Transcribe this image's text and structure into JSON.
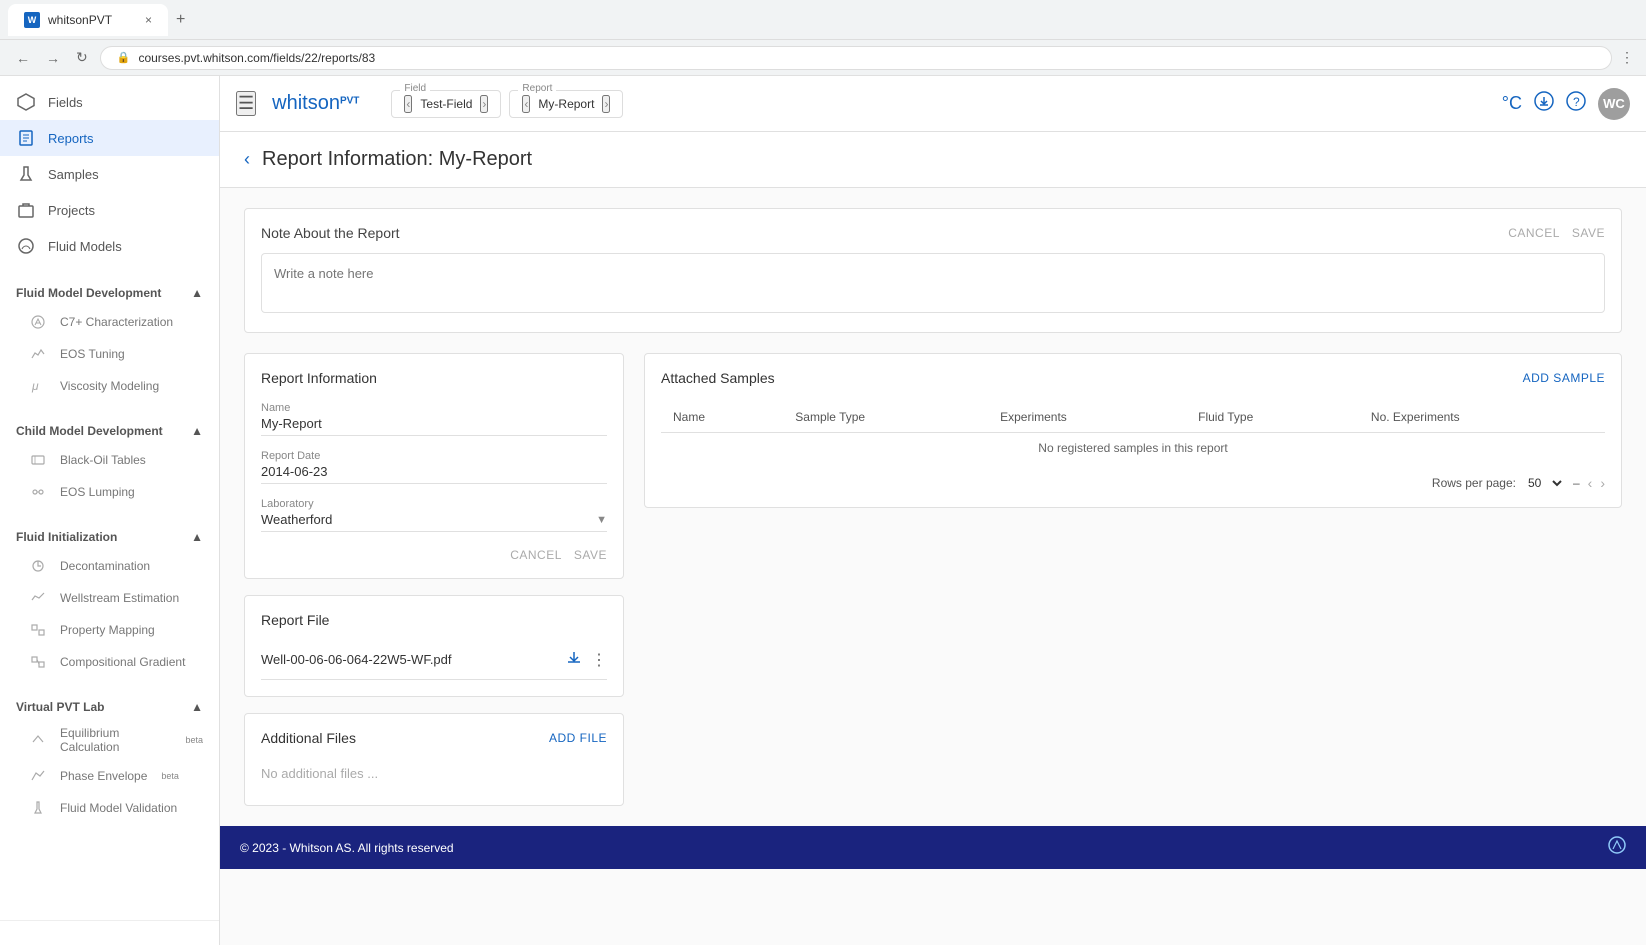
{
  "browser": {
    "tab_label": "whitsonPVT",
    "url": "courses.pvt.whitson.com/fields/22/reports/83",
    "favicon": "W"
  },
  "header": {
    "menu_icon": "☰",
    "logo_text": "whitson",
    "logo_pvt": "PVT",
    "field_label": "Field",
    "field_value": "Test-Field",
    "report_label": "Report",
    "report_value": "My-Report",
    "celsius_icon": "°C",
    "download_icon": "⬇",
    "help_icon": "?",
    "user_avatar": "WC"
  },
  "page": {
    "back_icon": "‹",
    "title": "Report Information: My-Report"
  },
  "note": {
    "title": "Note About the Report",
    "cancel_label": "CANCEL",
    "save_label": "SAVE",
    "placeholder": "Write a note here"
  },
  "report_info": {
    "title": "Report Information",
    "name_label": "Name",
    "name_value": "My-Report",
    "date_label": "Report Date",
    "date_value": "2014-06-23",
    "lab_label": "Laboratory",
    "lab_value": "Weatherford",
    "cancel_label": "CANCEL",
    "save_label": "SAVE"
  },
  "attached_samples": {
    "title": "Attached Samples",
    "add_btn": "ADD SAMPLE",
    "columns": [
      "Name",
      "Sample Type",
      "Experiments",
      "Fluid Type",
      "No. Experiments"
    ],
    "no_data": "No registered samples in this report",
    "rows_per_page_label": "Rows per page:",
    "rows_per_page_value": "50"
  },
  "report_file": {
    "title": "Report File",
    "file_name": "Well-00-06-06-064-22W5-WF.pdf",
    "download_icon": "⬇",
    "menu_icon": "⋮"
  },
  "additional_files": {
    "title": "Additional Files",
    "add_btn": "ADD FILE",
    "no_files": "No additional files ..."
  },
  "sidebar": {
    "nav_items": [
      {
        "label": "Fields",
        "icon": "⬡",
        "active": false
      },
      {
        "label": "Reports",
        "icon": "📄",
        "active": true
      },
      {
        "label": "Samples",
        "icon": "🧪",
        "active": false
      },
      {
        "label": "Projects",
        "icon": "📁",
        "active": false
      },
      {
        "label": "Fluid Models",
        "icon": "💧",
        "active": false
      }
    ],
    "fluid_model_dev": {
      "label": "Fluid Model Development",
      "children": [
        {
          "label": "C7+ Characterization"
        },
        {
          "label": "EOS Tuning"
        },
        {
          "label": "Viscosity Modeling"
        }
      ]
    },
    "child_model_dev": {
      "label": "Child Model Development",
      "children": [
        {
          "label": "Black-Oil Tables"
        },
        {
          "label": "EOS Lumping"
        }
      ]
    },
    "fluid_init": {
      "label": "Fluid Initialization",
      "children": [
        {
          "label": "Decontamination"
        },
        {
          "label": "Wellstream Estimation"
        },
        {
          "label": "Property Mapping"
        },
        {
          "label": "Compositional Gradient"
        }
      ]
    },
    "virtual_pvt": {
      "label": "Virtual PVT Lab",
      "children": [
        {
          "label": "Equilibrium Calculation",
          "badge": "beta"
        },
        {
          "label": "Phase Envelope",
          "badge": "beta"
        },
        {
          "label": "Fluid Model Validation"
        }
      ]
    }
  },
  "footer": {
    "copyright": "© 2023 - Whitson AS. All rights reserved"
  }
}
